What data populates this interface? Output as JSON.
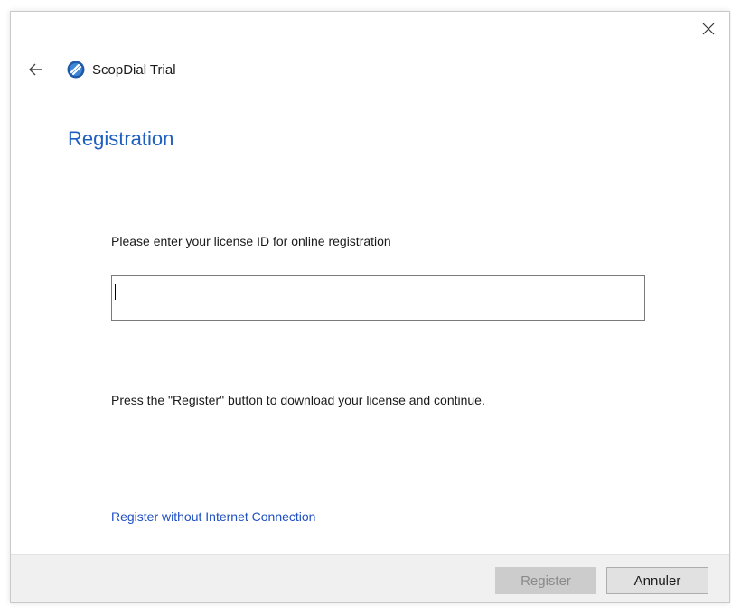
{
  "window": {
    "app_title": "ScopDial Trial",
    "page_title": "Registration"
  },
  "form": {
    "prompt": "Please enter your license ID for online registration",
    "license_value": "",
    "hint": "Press the \"Register\" button to download your license and continue.",
    "offline_link": "Register without Internet Connection"
  },
  "footer": {
    "register_label": "Register",
    "register_enabled": false,
    "cancel_label": "Annuler"
  },
  "icons": {
    "close": "close-icon",
    "back": "back-arrow-icon",
    "logo": "scopdial-logo-icon"
  },
  "colors": {
    "title": "#1f5fbf",
    "link": "#1f4fc4",
    "footer_bg": "#f0f0f0",
    "disabled_button": "#cccccc"
  }
}
